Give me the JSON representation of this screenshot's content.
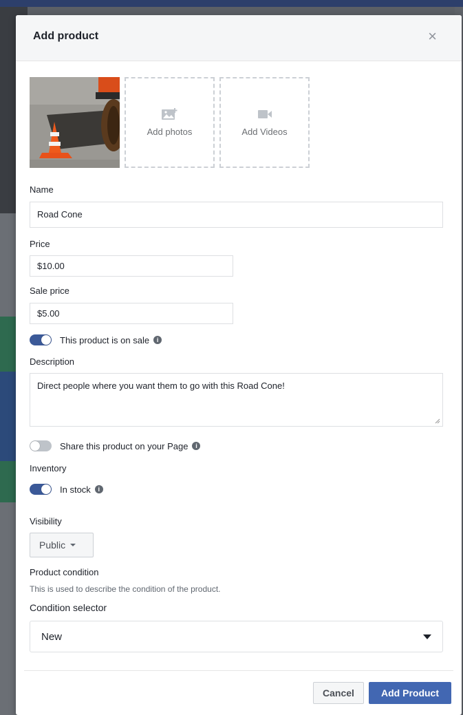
{
  "modal": {
    "title": "Add product",
    "close_icon": "close-icon"
  },
  "media": {
    "thumbnail_icon": "road-cone-photo",
    "add_photos_label": "Add photos",
    "add_photos_icon": "add-photo-icon",
    "add_videos_label": "Add Videos",
    "add_videos_icon": "video-camera-icon"
  },
  "form": {
    "name_label": "Name",
    "name_value": "Road Cone",
    "price_label": "Price",
    "price_value": "$10.00",
    "sale_price_label": "Sale price",
    "sale_price_value": "$5.00",
    "on_sale_toggle_label": "This product is on sale",
    "on_sale_enabled": true,
    "description_label": "Description",
    "description_value": "Direct people where you want them to go with this Road Cone!",
    "share_toggle_label": "Share this product on your Page",
    "share_enabled": false,
    "inventory_label": "Inventory",
    "in_stock_label": "In stock",
    "in_stock_enabled": true,
    "visibility_label": "Visibility",
    "visibility_value": "Public",
    "condition_heading": "Product condition",
    "condition_description": "This is used to describe the condition of the product.",
    "condition_selector_label": "Condition selector",
    "condition_value": "New"
  },
  "footer": {
    "cancel_label": "Cancel",
    "add_product_label": "Add Product"
  },
  "colors": {
    "accent": "#4267b2",
    "toggle_on": "#3b5998",
    "toggle_off": "#bec3c9"
  }
}
